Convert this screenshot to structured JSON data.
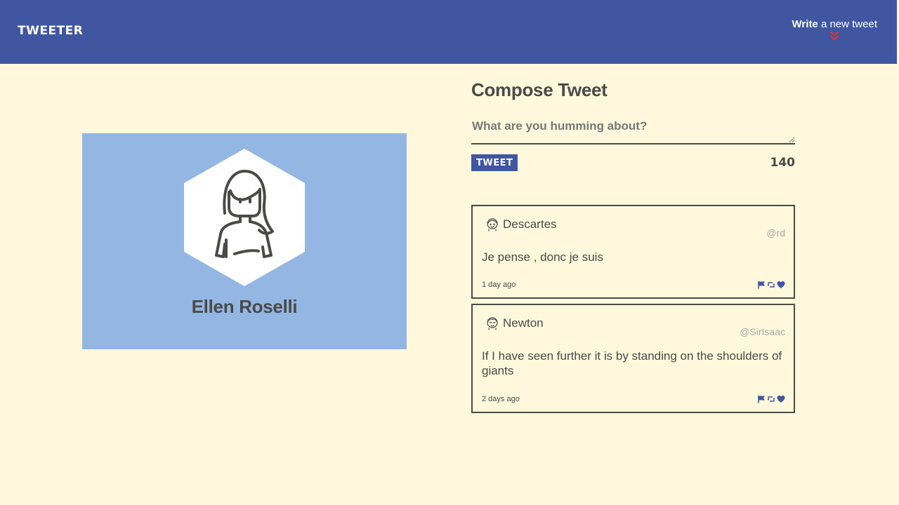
{
  "header": {
    "logo": "TWEETER",
    "compose_bold": "Write",
    "compose_rest": " a new tweet",
    "colors": {
      "nav": "#4056a1",
      "chevron": "#e0332e"
    }
  },
  "profile": {
    "name": "Ellen Roselli",
    "background_color": "#94b6e3"
  },
  "compose": {
    "title": "Compose Tweet",
    "placeholder": "What are you humming about?",
    "button_label": "TWEET",
    "counter": "140"
  },
  "tweets": [
    {
      "name": "Descartes",
      "handle": "@rd",
      "content": "Je pense , donc je suis",
      "time": "1 day ago",
      "actions": [
        "flag-icon",
        "retweet-icon",
        "heart-icon"
      ]
    },
    {
      "name": "Newton",
      "handle": "@SirIsaac",
      "content": "If I have seen further it is by standing on the shoulders of giants",
      "time": "2 days ago",
      "actions": [
        "flag-icon",
        "retweet-icon",
        "heart-icon"
      ]
    }
  ],
  "colors": {
    "page_background": "#fff8dc",
    "text": "#4a4a48",
    "accent": "#4056a1"
  }
}
